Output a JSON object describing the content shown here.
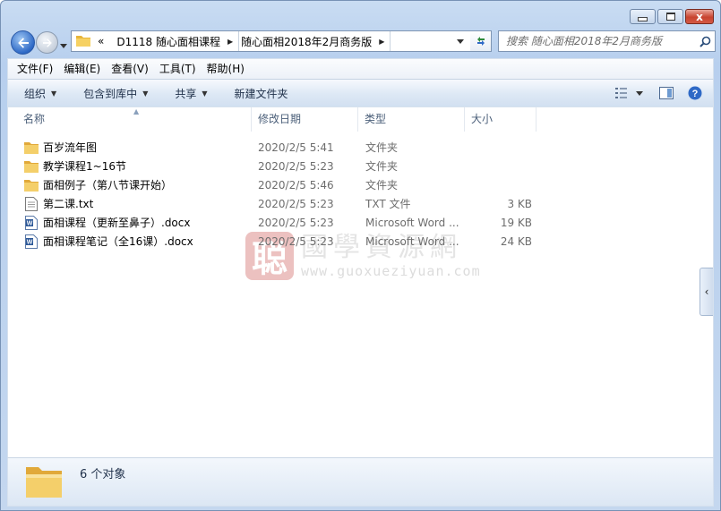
{
  "window": {
    "minimize_label": "",
    "maximize_label": "",
    "close_label": "x"
  },
  "address": {
    "prefix": "«",
    "segments": [
      "D1118 随心面相课程",
      "随心面相2018年2月商务版"
    ]
  },
  "search": {
    "placeholder": "搜索 随心面相2018年2月商务版"
  },
  "menu": [
    "文件(F)",
    "编辑(E)",
    "查看(V)",
    "工具(T)",
    "帮助(H)"
  ],
  "toolbar": {
    "organize": "组织",
    "include_library": "包含到库中",
    "share": "共享",
    "new_folder": "新建文件夹"
  },
  "columns": {
    "name": "名称",
    "date": "修改日期",
    "type": "类型",
    "size": "大小"
  },
  "files": [
    {
      "name": "百岁流年图",
      "date": "2020/2/5 5:41",
      "type": "文件夹",
      "size": "",
      "icon": "folder-icon"
    },
    {
      "name": "教学课程1~16节",
      "date": "2020/2/5 5:23",
      "type": "文件夹",
      "size": "",
      "icon": "folder-icon"
    },
    {
      "name": "面相例子（第八节课开始）",
      "date": "2020/2/5 5:46",
      "type": "文件夹",
      "size": "",
      "icon": "folder-icon"
    },
    {
      "name": "第二课.txt",
      "date": "2020/2/5 5:23",
      "type": "TXT 文件",
      "size": "3 KB",
      "icon": "txt-file-icon"
    },
    {
      "name": "面相课程（更新至鼻子）.docx",
      "date": "2020/2/5 5:23",
      "type": "Microsoft Word ...",
      "size": "19 KB",
      "icon": "word-doc-icon"
    },
    {
      "name": "面相课程笔记（全16课）.docx",
      "date": "2020/2/5 5:23",
      "type": "Microsoft Word ...",
      "size": "24 KB",
      "icon": "word-doc-icon"
    }
  ],
  "watermark": {
    "seal": "聪",
    "chinese": "國學資源網",
    "url": "www.guoxueziyuan.com"
  },
  "status": {
    "count": "6 个对象"
  },
  "colors": {
    "folder": "#f2c94c",
    "word": "#2b5797",
    "accent": "#2e69c6",
    "close": "#c8432f"
  }
}
